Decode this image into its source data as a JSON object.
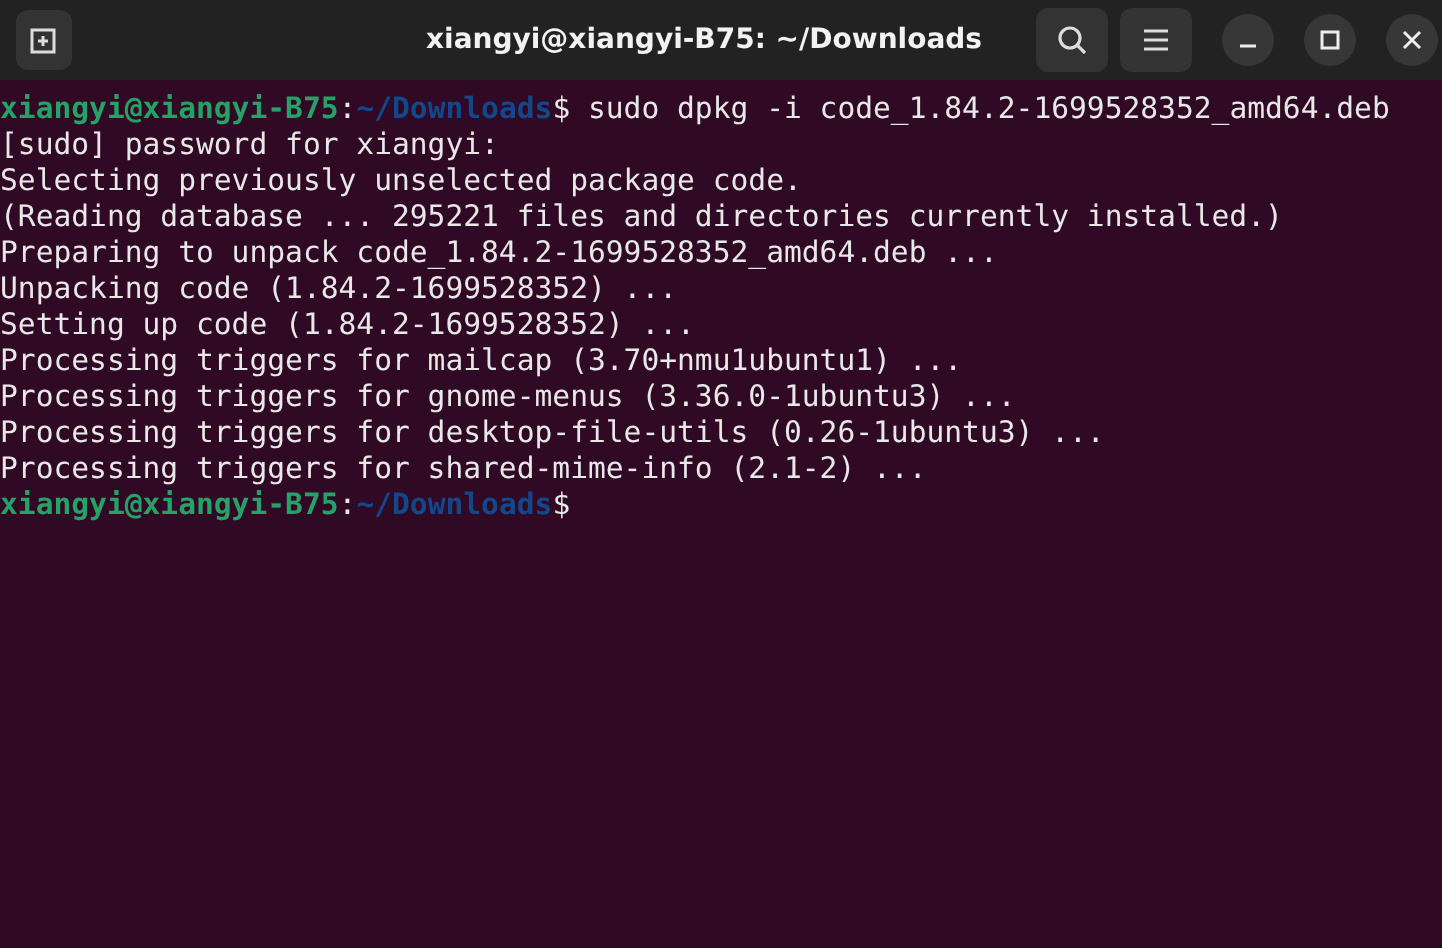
{
  "window": {
    "title": "xiangyi@xiangyi-B75: ~/Downloads"
  },
  "terminal": {
    "lines": [
      {
        "kind": "prompt",
        "user": "xiangyi@xiangyi-B75",
        "colon": ":",
        "path": "~/Downloads",
        "symbol": "$",
        "command": "sudo dpkg -i code_1.84.2-1699528352_amd64.deb"
      },
      {
        "kind": "output",
        "text": "[sudo] password for xiangyi:"
      },
      {
        "kind": "output",
        "text": "Selecting previously unselected package code."
      },
      {
        "kind": "output",
        "text": "(Reading database ... 295221 files and directories currently installed.)"
      },
      {
        "kind": "output",
        "text": "Preparing to unpack code_1.84.2-1699528352_amd64.deb ..."
      },
      {
        "kind": "output",
        "text": "Unpacking code (1.84.2-1699528352) ..."
      },
      {
        "kind": "output",
        "text": "Setting up code (1.84.2-1699528352) ..."
      },
      {
        "kind": "output",
        "text": "Processing triggers for mailcap (3.70+nmu1ubuntu1) ..."
      },
      {
        "kind": "output",
        "text": "Processing triggers for gnome-menus (3.36.0-1ubuntu3) ..."
      },
      {
        "kind": "output",
        "text": "Processing triggers for desktop-file-utils (0.26-1ubuntu3) ..."
      },
      {
        "kind": "output",
        "text": "Processing triggers for shared-mime-info (2.1-2) ..."
      },
      {
        "kind": "prompt",
        "user": "xiangyi@xiangyi-B75",
        "colon": ":",
        "path": "~/Downloads",
        "symbol": "$"
      }
    ]
  }
}
